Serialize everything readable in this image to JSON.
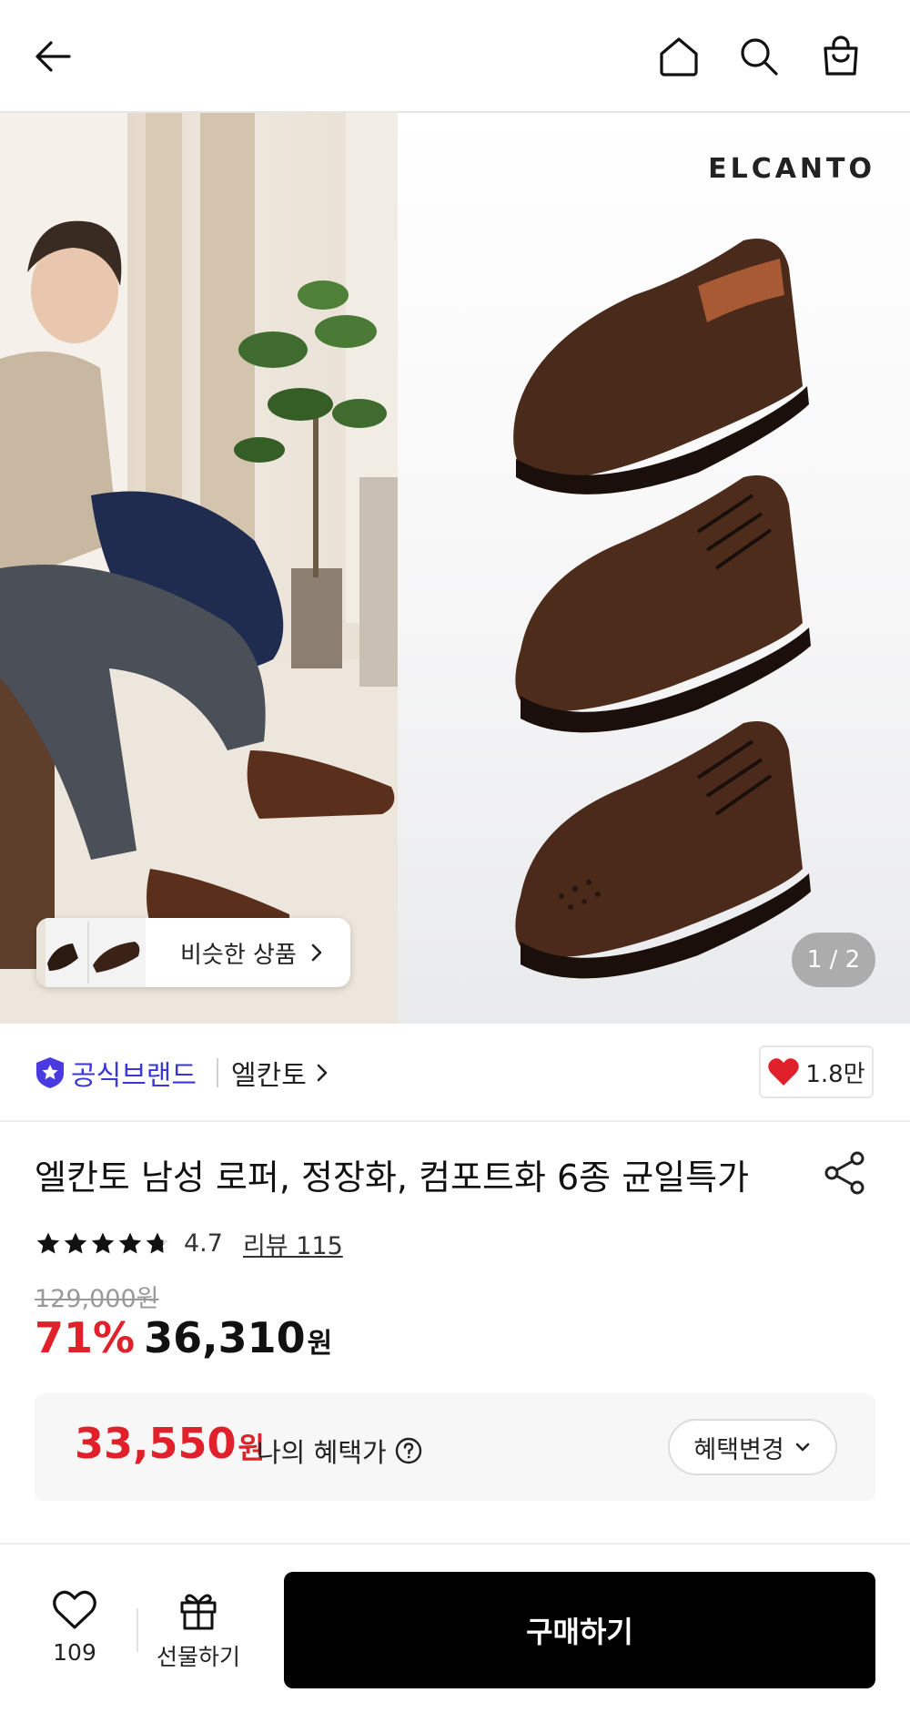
{
  "topbar": {
    "back_icon": "arrow-left-icon",
    "home_icon": "home-icon",
    "search_icon": "search-icon",
    "cart_icon": "shopping-bag-icon"
  },
  "hero": {
    "brand_logo": "ELCANTO",
    "similar_label": "비슷한 상품",
    "counter": "1 / 2"
  },
  "brand_row": {
    "official_label": "공식브랜드",
    "brand_name": "엘칸토",
    "like_count": "1.8만"
  },
  "product": {
    "title": "엘칸토 남성 로퍼, 정장화, 컴포트화 6종 균일특가",
    "rating": "4.7",
    "stars_filled_fraction": 0.94,
    "reviews_label": "리뷰 115",
    "original_price": "129,000원",
    "discount": "71%",
    "price": "36,310",
    "price_unit": "원"
  },
  "benefit": {
    "price": "33,550",
    "unit": "원",
    "label": "나의 혜택가",
    "change_label": "혜택변경"
  },
  "bottom_bar": {
    "wish_count": "109",
    "gift_label": "선물하기",
    "buy_label": "구매하기"
  },
  "colors": {
    "accent_red": "#e0202a",
    "official_blue": "#3a36d9",
    "buy_button": "#000000"
  }
}
